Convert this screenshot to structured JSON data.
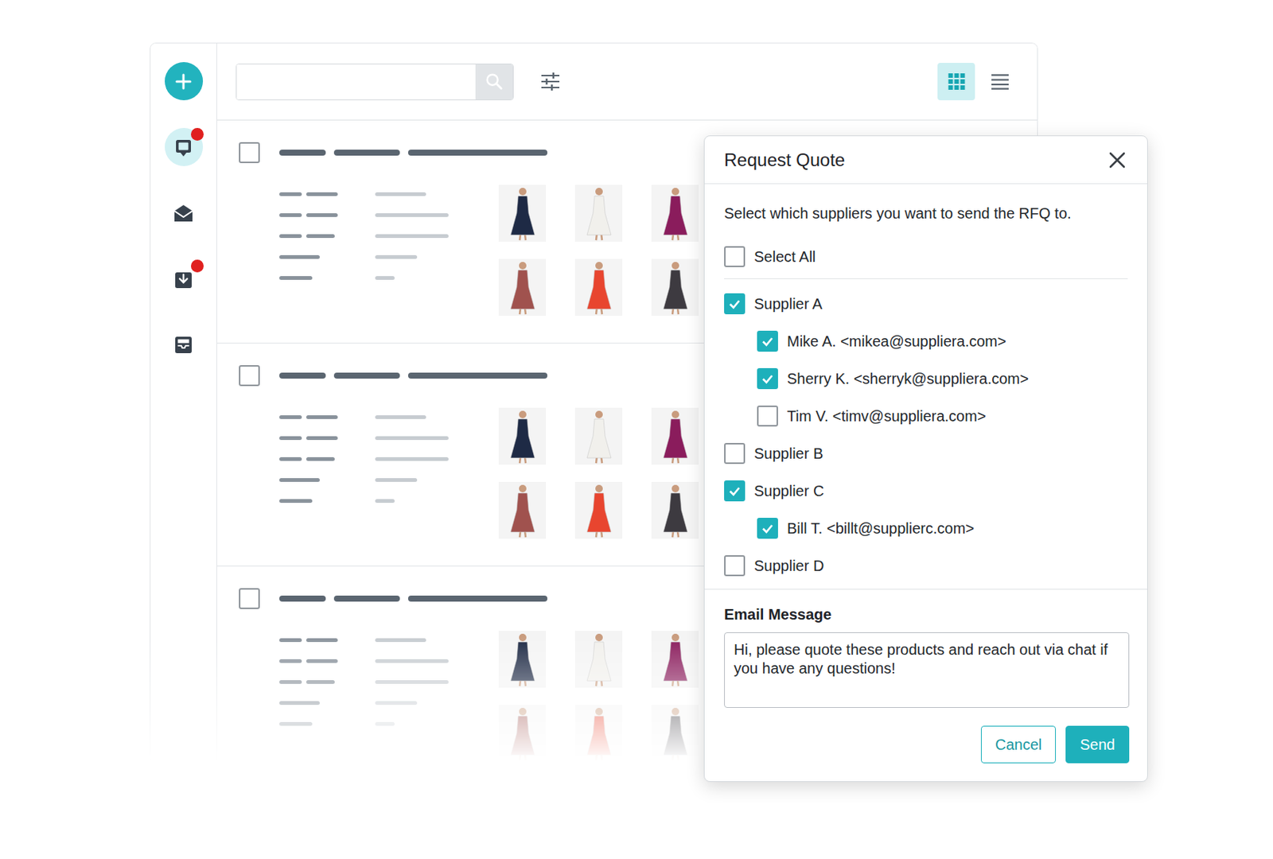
{
  "sidebar": {
    "items": [
      {
        "kind": "add",
        "selected": false,
        "badge": false
      },
      {
        "kind": "quotes",
        "selected": true,
        "badge": true
      },
      {
        "kind": "mail",
        "selected": false,
        "badge": false
      },
      {
        "kind": "download",
        "selected": false,
        "badge": true
      },
      {
        "kind": "inbox",
        "selected": false,
        "badge": false
      }
    ]
  },
  "toolbar": {
    "search": {
      "placeholder": "",
      "value": ""
    },
    "views": [
      {
        "kind": "grid",
        "selected": true
      },
      {
        "kind": "list",
        "selected": false
      }
    ]
  },
  "list": {
    "rows": [
      {
        "checked": false,
        "images": [
          {
            "color": "#1e2a45"
          },
          {
            "color": "#f1f0ec"
          },
          {
            "color": "#8a1c5c"
          },
          {
            "color": "#a0524e"
          },
          {
            "color": "#e8452f"
          },
          {
            "color": "#3d3a40"
          }
        ]
      },
      {
        "checked": false,
        "images": [
          {
            "color": "#1e2a45"
          },
          {
            "color": "#f1f0ec"
          },
          {
            "color": "#8a1c5c"
          },
          {
            "color": "#a0524e"
          },
          {
            "color": "#e8452f"
          },
          {
            "color": "#3d3a40"
          }
        ]
      },
      {
        "checked": false,
        "images": [
          {
            "color": "#1e2a45"
          },
          {
            "color": "#f1f0ec"
          },
          {
            "color": "#8a1c5c"
          },
          {
            "color": "#a0524e"
          },
          {
            "color": "#e8452f"
          },
          {
            "color": "#3d3a40"
          }
        ]
      }
    ]
  },
  "dialog": {
    "title": "Request Quote",
    "intro": "Select which suppliers you want to send the RFQ to.",
    "select_all": {
      "label": "Select All",
      "checked": false
    },
    "suppliers": [
      {
        "name": "Supplier A",
        "checked": true,
        "contacts": [
          {
            "label": "Mike A. <mikea@suppliera.com>",
            "checked": true
          },
          {
            "label": "Sherry K. <sherryk@suppliera.com>",
            "checked": true
          },
          {
            "label": "Tim V. <timv@suppliera.com>",
            "checked": false
          }
        ]
      },
      {
        "name": "Supplier B",
        "checked": false,
        "contacts": []
      },
      {
        "name": "Supplier C",
        "checked": true,
        "contacts": [
          {
            "label": "Bill T. <billt@supplierc.com>",
            "checked": true
          }
        ]
      },
      {
        "name": "Supplier D",
        "checked": false,
        "contacts": []
      }
    ],
    "message": {
      "label": "Email Message",
      "value": "Hi, please quote these products and reach out via chat if you have any questions!"
    },
    "buttons": [
      {
        "label": "Cancel",
        "kind": "secondary"
      },
      {
        "label": "Send",
        "kind": "primary"
      }
    ]
  }
}
